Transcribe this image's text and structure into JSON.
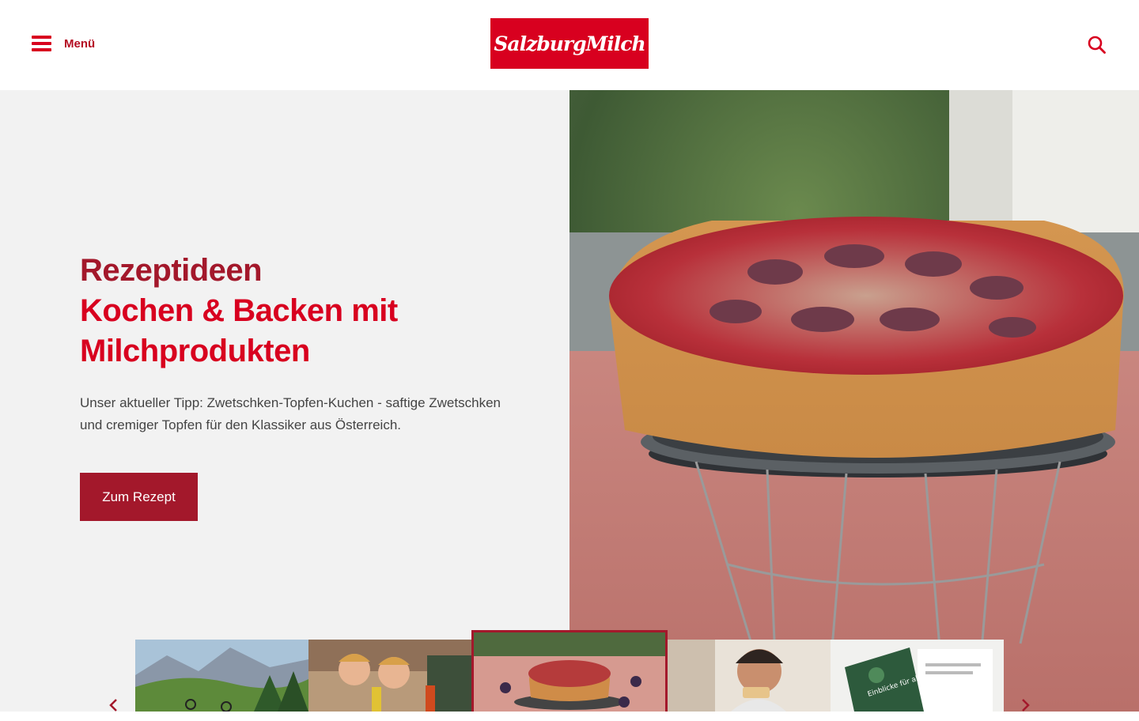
{
  "header": {
    "menu_label": "Menü",
    "logo_text": "SalzburgMilch",
    "icons": {
      "menu": "hamburger-icon",
      "search": "search-icon"
    }
  },
  "hero": {
    "title_line1": "Rezeptideen",
    "title_line2": "Kochen & Backen mit Milchprodukten",
    "description": "Unser aktueller Tipp: Zwetschken-Topfen-Kuchen - saftige Zwetschken und cremiger Topfen für den Klassiker aus Österreich.",
    "cta_label": "Zum Rezept",
    "image": "plum-cake-on-stand"
  },
  "carousel": {
    "active_index": 2,
    "thumbnails": [
      {
        "image": "mountain-bikers-alpine-meadow"
      },
      {
        "image": "boys-with-drinks"
      },
      {
        "image": "plum-cake"
      },
      {
        "image": "man-eating-bread"
      },
      {
        "image": "brochure-einblicke-fur-alle",
        "text": "Einblicke für alle"
      }
    ],
    "icons": {
      "prev": "chevron-left-icon",
      "next": "chevron-right-icon"
    }
  },
  "colors": {
    "brand_red": "#d8001f",
    "dark_red": "#a3182b",
    "hero_bg": "#f2f2f2"
  }
}
